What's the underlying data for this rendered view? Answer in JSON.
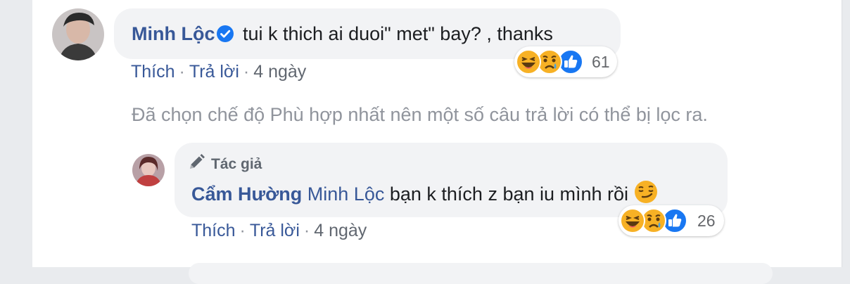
{
  "comment1": {
    "author": "Minh Lộc",
    "text": "tui k thich ai duoi\" met\" bay? , thanks",
    "reaction_count": "61",
    "reactions": [
      "haha-icon",
      "sad-icon",
      "like-icon"
    ],
    "actions": {
      "like": "Thích",
      "reply": "Trả lời",
      "sep": "·",
      "time": "4 ngày"
    }
  },
  "filter_notice": "Đã chọn chế độ Phù hợp nhất nên một số câu trả lời có thể bị lọc ra.",
  "reply1": {
    "badge": "Tác giả",
    "author": "Cẩm Hường",
    "mention": "Minh Lộc",
    "text": "bạn k thích z bạn iu mình rồi",
    "reaction_count": "26",
    "reactions": [
      "haha-icon",
      "sad-icon",
      "like-icon"
    ],
    "actions": {
      "like": "Thích",
      "reply": "Trả lời",
      "sep": "·",
      "time": "4 ngày"
    }
  },
  "colors": {
    "link": "#385898",
    "bubble": "#f2f3f5",
    "muted": "#90949c",
    "like_blue": "#1877f2",
    "emoji_yellow": "#f7b125"
  }
}
